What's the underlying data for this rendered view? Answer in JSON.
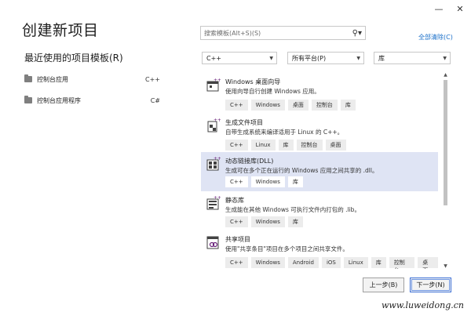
{
  "window": {
    "minimize_icon": "minimize-icon",
    "close_icon": "close-icon"
  },
  "page_title": "创建新项目",
  "recent": {
    "title": "最近使用的项目模板(R)",
    "items": [
      {
        "label": "控制台应用",
        "lang": "C++"
      },
      {
        "label": "控制台应用程序",
        "lang": "C#"
      }
    ]
  },
  "search": {
    "placeholder": "搜索模板(Alt+S)(S)",
    "icon": "search-icon"
  },
  "clear_all": "全部清除(C)",
  "filters": {
    "language": "C++",
    "platform": "所有平台(P)",
    "type": "库"
  },
  "templates": [
    {
      "name": "Windows 桌面向导",
      "description": "使用向导自行创建 Windows 应用。",
      "tags": [
        "C++",
        "Windows",
        "桌面",
        "控制台",
        "库"
      ],
      "selected": false
    },
    {
      "name": "生成文件项目",
      "description": "自带生成系统来编译适用于 Linux 的 C++。",
      "tags": [
        "C++",
        "Linux",
        "库",
        "控制台",
        "桌面"
      ],
      "selected": false
    },
    {
      "name": "动态链接库(DLL)",
      "description": "生成可在多个正在运行的 Windows 应用之间共享的 .dll。",
      "tags": [
        "C++",
        "Windows",
        "库"
      ],
      "selected": true
    },
    {
      "name": "静态库",
      "description": "生成能在其他 Windows 可执行文件内打包的 .lib。",
      "tags": [
        "C++",
        "Windows",
        "库"
      ],
      "selected": false
    },
    {
      "name": "共享项目",
      "description": "使用\"共享条目\"项目在多个项目之间共享文件。",
      "tags": [
        "C++",
        "Windows",
        "Android",
        "iOS",
        "Linux",
        "库",
        "控制台",
        "桌面"
      ],
      "selected": false
    }
  ],
  "buttons": {
    "back": "上一步(B)",
    "next": "下一步(N)"
  },
  "watermark": "www.luweidong.cn",
  "colors": {
    "selected_bg": "#dfe4f4",
    "link": "#1a6fc9",
    "accent_purple": "#68217a"
  }
}
